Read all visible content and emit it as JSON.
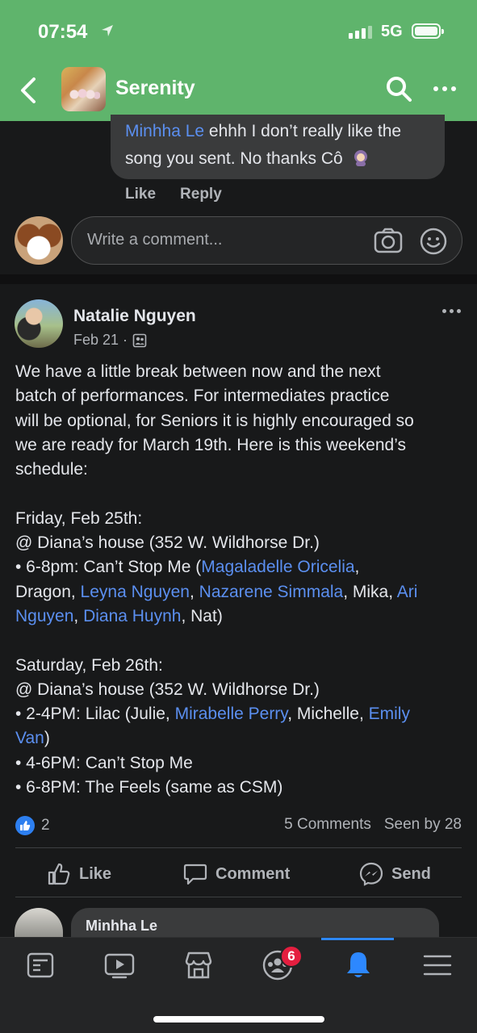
{
  "colors": {
    "header_bg": "#5fb46c",
    "link": "#5b8ff0",
    "accent": "#2d88ff",
    "badge": "#e41e3f"
  },
  "status_bar": {
    "time": "07:54",
    "network": "5G"
  },
  "header": {
    "group_name": "Serenity",
    "back_icon": "chevron-left-icon",
    "search_icon": "search-icon",
    "more_icon": "more-icon"
  },
  "previous_comment": {
    "author": "Minhha Le",
    "text_line1": "ehhh I don’t really like the",
    "text_line2": "song you sent. No thanks Cô",
    "like_label": "Like",
    "reply_label": "Reply"
  },
  "composer": {
    "placeholder": "Write a comment...",
    "camera_icon": "camera-icon",
    "emoji_icon": "smiley-icon"
  },
  "post": {
    "author": "Natalie Nguyen",
    "date": "Feb 21 ·",
    "audience_icon": "group-icon",
    "lines": {
      "l1": "We have a little break between now and the next",
      "l2": "batch of performances. For intermediates practice",
      "l3": "will be optional, for Seniors it is highly encouraged so",
      "l4": "we are ready for March 19th. Here is this weekend’s",
      "l5": "schedule:",
      "l7": "Friday, Feb 25th:",
      "l8": "@ Diana’s house (352 W. Wildhorse Dr.)",
      "l9_a": "• 6-8pm: Can’t Stop Me (",
      "l9_b": "Magaladelle Oricelia",
      "l9_c": ",",
      "l10_a": "Dragon, ",
      "l10_b": "Leyna Nguyen",
      "l10_c": ", ",
      "l10_d": "Nazarene Simmala",
      "l10_e": ", Mika, ",
      "l10_f": "Ari",
      "l11_a": "Nguyen",
      "l11_b": ", ",
      "l11_c": "Diana Huynh",
      "l11_d": ", Nat)",
      "l13": "Saturday, Feb 26th:",
      "l14": "@ Diana’s house (352 W. Wildhorse Dr.)",
      "l15_a": "• 2-4PM: Lilac (Julie, ",
      "l15_b": "Mirabelle Perry",
      "l15_c": ", Michelle, ",
      "l15_d": "Emily",
      "l16_a": "Van",
      "l16_b": ")",
      "l17": "• 4-6PM: Can’t Stop Me",
      "l18": "• 6-8PM: The Feels (same as CSM)"
    },
    "like_count": "2",
    "comments_count": "5 Comments",
    "seen_by": "Seen by 28"
  },
  "actions": {
    "like": "Like",
    "comment": "Comment",
    "send": "Send"
  },
  "next_comment": {
    "author": "Minhha Le"
  },
  "tab_bar": {
    "items": [
      "feed-icon",
      "watch-icon",
      "marketplace-icon",
      "groups-icon",
      "notifications-icon",
      "menu-icon"
    ],
    "groups_badge": "6",
    "active": "notifications-icon"
  }
}
